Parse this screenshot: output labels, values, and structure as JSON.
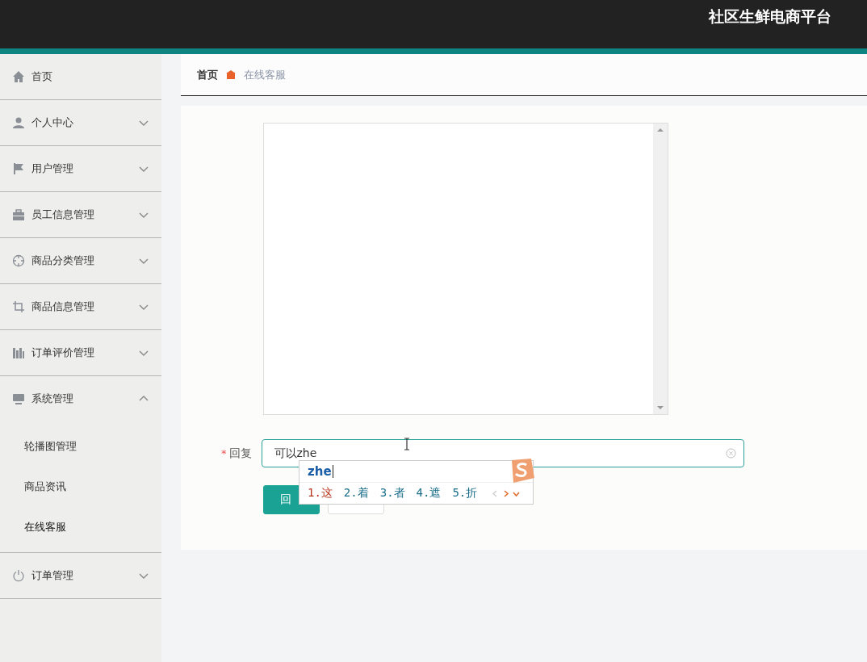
{
  "header": {
    "title": "社区生鲜电商平台"
  },
  "sidebar": {
    "items": [
      {
        "label": "首页",
        "kind": "home"
      },
      {
        "label": "个人中心",
        "kind": "person",
        "expanded": false
      },
      {
        "label": "用户管理",
        "kind": "flag",
        "expanded": false
      },
      {
        "label": "员工信息管理",
        "kind": "briefcase",
        "expanded": false
      },
      {
        "label": "商品分类管理",
        "kind": "target",
        "expanded": false
      },
      {
        "label": "商品信息管理",
        "kind": "crop",
        "expanded": false
      },
      {
        "label": "订单评价管理",
        "kind": "chart",
        "expanded": false
      },
      {
        "label": "系统管理",
        "kind": "monitor",
        "expanded": true,
        "children": [
          {
            "label": "轮播图管理",
            "selected": false
          },
          {
            "label": "商品资讯",
            "selected": false
          },
          {
            "label": "在线客服",
            "selected": true
          }
        ]
      },
      {
        "label": "订单管理",
        "kind": "power",
        "expanded": false
      }
    ]
  },
  "breadcrumb": [
    {
      "label": "首页",
      "current": false
    },
    {
      "label": "在线客服",
      "current": true
    }
  ],
  "form": {
    "reply_label": "回复",
    "required_mark": "*",
    "reply_value": "可以zhe",
    "buttons": [
      {
        "label": "回",
        "kind": "primary"
      },
      {
        "kind": "default"
      }
    ]
  },
  "ime": {
    "composition": "zhe",
    "candidates": [
      {
        "label": "1.这",
        "selected": true
      },
      {
        "label": "2.着",
        "selected": false
      },
      {
        "label": "3.者",
        "selected": false
      },
      {
        "label": "4.遮",
        "selected": false
      },
      {
        "label": "5.折",
        "selected": false
      }
    ]
  }
}
